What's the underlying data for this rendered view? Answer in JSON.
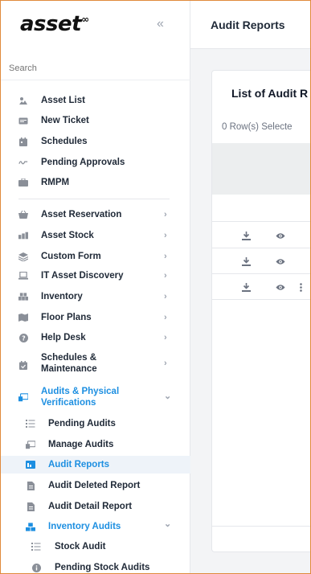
{
  "brand": {
    "logo_text": "asset",
    "logo_mark": "∞"
  },
  "sidebar": {
    "search_placeholder": "Search",
    "items": [
      {
        "label": "Asset List",
        "icon": "map-pin-icon"
      },
      {
        "label": "New Ticket",
        "icon": "ticket-icon"
      },
      {
        "label": "Schedules",
        "icon": "calendar-icon"
      },
      {
        "label": "Pending Approvals",
        "icon": "signature-icon"
      },
      {
        "label": "RMPM",
        "icon": "toolbox-icon"
      },
      {
        "label": "Asset Reservation",
        "icon": "basket-icon"
      },
      {
        "label": "Asset Stock",
        "icon": "stock-icon"
      },
      {
        "label": "Custom Form",
        "icon": "layers-icon"
      },
      {
        "label": "IT Asset Discovery",
        "icon": "laptop-icon"
      },
      {
        "label": "Inventory",
        "icon": "inventory-icon"
      },
      {
        "label": "Floor Plans",
        "icon": "map-icon"
      },
      {
        "label": "Help Desk",
        "icon": "help-icon"
      },
      {
        "label": "Schedules &",
        "label2": "Maintenance",
        "icon": "calendar-check-icon"
      },
      {
        "label": "Audits & Physical",
        "label2": "Verifications",
        "icon": "audit-icon"
      }
    ],
    "audit_sub": [
      {
        "label": "Pending Audits",
        "icon": "list-icon"
      },
      {
        "label": "Manage Audits",
        "icon": "audit-icon"
      },
      {
        "label": "Audit Reports",
        "icon": "report-icon"
      },
      {
        "label": "Audit Deleted Report",
        "icon": "file-icon"
      },
      {
        "label": "Audit Detail Report",
        "icon": "file-icon"
      },
      {
        "label": "Inventory Audits",
        "icon": "cubes-icon"
      }
    ],
    "inventory_sub": [
      {
        "label": "Stock Audit",
        "icon": "list-icon"
      },
      {
        "label": "Pending Stock Audits",
        "icon": "info-icon"
      }
    ]
  },
  "header": {
    "title": "Audit Reports"
  },
  "main": {
    "card_title": "List of Audit R",
    "rows_selected": "0 Row(s) Selecte"
  },
  "colors": {
    "accent": "#1d8fe1",
    "frame": "#e08a3c"
  }
}
